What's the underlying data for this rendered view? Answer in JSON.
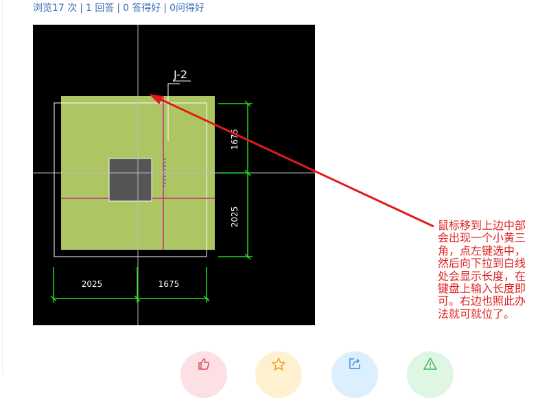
{
  "stats": {
    "views": "浏览17 次",
    "answers": "1 回答",
    "good_answers": "0 答得好",
    "good_questions": "0问得好"
  },
  "drawing": {
    "label": "J-2",
    "dim_top": "1675",
    "dim_right": "2025",
    "dim_bottom_left": "2025",
    "dim_bottom_right": "1675"
  },
  "callout": {
    "line1": "鼠标移到上边中部",
    "line2": "会出现一个小黄三",
    "line3": "角，点左键选中，",
    "line4": "然后向下拉到白线",
    "line5": "处会显示长度，在",
    "line6": "键盘上输入长度即",
    "line7": "可。右边也照此办",
    "line8": "法就可就位了。"
  },
  "actions": [
    {
      "icon": "thumbs-up-icon",
      "color": "#fde0e3"
    },
    {
      "icon": "star-icon",
      "color": "#fff0cf"
    },
    {
      "icon": "share-icon",
      "color": "#dcefff"
    },
    {
      "icon": "warning-icon",
      "color": "#dff6e4"
    }
  ]
}
